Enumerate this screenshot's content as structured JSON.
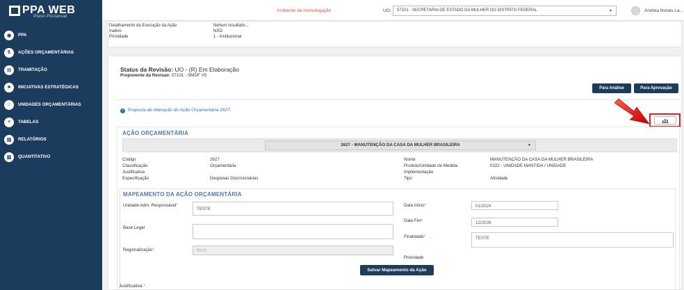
{
  "app": {
    "logo_text": "PPA WEB",
    "logo_subtitle": "Plano Plurianual"
  },
  "sidebar": {
    "items": [
      {
        "label": "PPA",
        "icon": "target-icon",
        "glyph": "◉"
      },
      {
        "label": "AÇÕES ORÇAMENTÁRIAS",
        "icon": "dollar-icon",
        "glyph": "$"
      },
      {
        "label": "TRAMITAÇÃO",
        "icon": "inbox-icon",
        "glyph": "⊟"
      },
      {
        "label": "INICIATIVAS ESTRATÉGICAS",
        "icon": "users-icon",
        "glyph": "♣"
      },
      {
        "label": "UNIDADES ORÇAMENTÁRIAS",
        "icon": "building-icon",
        "glyph": "⌂"
      },
      {
        "label": "TABELAS",
        "icon": "list-icon",
        "glyph": "≡"
      },
      {
        "label": "RELATÓRIOS",
        "icon": "file-icon",
        "glyph": "▤"
      },
      {
        "label": "QUANTITATIVO",
        "icon": "bar-chart-icon",
        "glyph": "▥"
      }
    ]
  },
  "topbar": {
    "environment": "Ambiente de Homologação",
    "uo_label": "UO:",
    "uo_value": "57101 - SECRETARIA DE ESTADO DA MULHER DO DISTRITO FEDERAL",
    "user_name": "Andrea Nunes La..."
  },
  "info_panel": [
    {
      "key": "Detalhamento da Execução da Ação",
      "value": "Nehum resultado..."
    },
    {
      "key": "Inativo",
      "value": "NÃO"
    },
    {
      "key": "Prioridade",
      "value": "1 - Institucional"
    }
  ],
  "revisao": {
    "status_label": "Status da Revisão:",
    "status_value": "UO - (R) Em Elaboração",
    "proponente_label": "Proponente da Revisao:",
    "proponente_value": "57101 - SMDF V5",
    "btn_analise": "Para Análise",
    "btn_aprovacao": "Para Aprovação"
  },
  "proposta_text": "Proposta de Alteração do Ação Orçamentária 2627.",
  "acao": {
    "title": "AÇÃO ORÇAMENTÁRIA",
    "selected": "2627 - MANUTENÇÃO DA CASA DA MULHER BRASILEIRA",
    "codigo_label": "Código",
    "codigo_value": "2627",
    "classificacao_label": "Classificação",
    "classificacao_value": "Orçamentária",
    "justificativa_label": "Justificativa",
    "justificativa_value": "",
    "especificacao_label": "Especificação",
    "especificacao_value": "Despesas Discricionárias",
    "nome_label": "Nome",
    "nome_value": "MANUTENÇÃO DA CASA DA MULHER BRASILEIRA",
    "produto_label": "Produto/Unidade de Medida",
    "produto_value": "0322 - UNIDADE MANTIDA / UNIDADE",
    "implementacao_label": "Implementação",
    "implementacao_value": "",
    "tipo_label": "Tipo",
    "tipo_value": "Atividade"
  },
  "mapeamento": {
    "title": "MAPEAMENTO DA AÇÃO ORÇAMENTÁRIA",
    "unidade_label": "Unidade Adm. Responsável",
    "unidade_value": "TESTE",
    "base_legal_label": "Base Legal",
    "base_legal_value": "",
    "regionalizacao_label": "Regionalização",
    "regionalizacao_value": "RA X",
    "data_inicio_label": "Data Início",
    "data_inicio_value": "01/2024",
    "data_fim_label": "Data Fim",
    "data_fim_value": "12/2026",
    "finalidade_label": "Finalidade",
    "finalidade_value": "TESTE",
    "prioridade_label": "Prioridade",
    "save_label": "Salvar Mapeamento da Ação"
  },
  "justificativa_label": "Justificativa",
  "required_mark": "*",
  "colors": {
    "sidebar": "#1c3c5e",
    "accent": "#2a6db0",
    "button": "#1e3b5a",
    "highlight": "#e41e1e"
  }
}
